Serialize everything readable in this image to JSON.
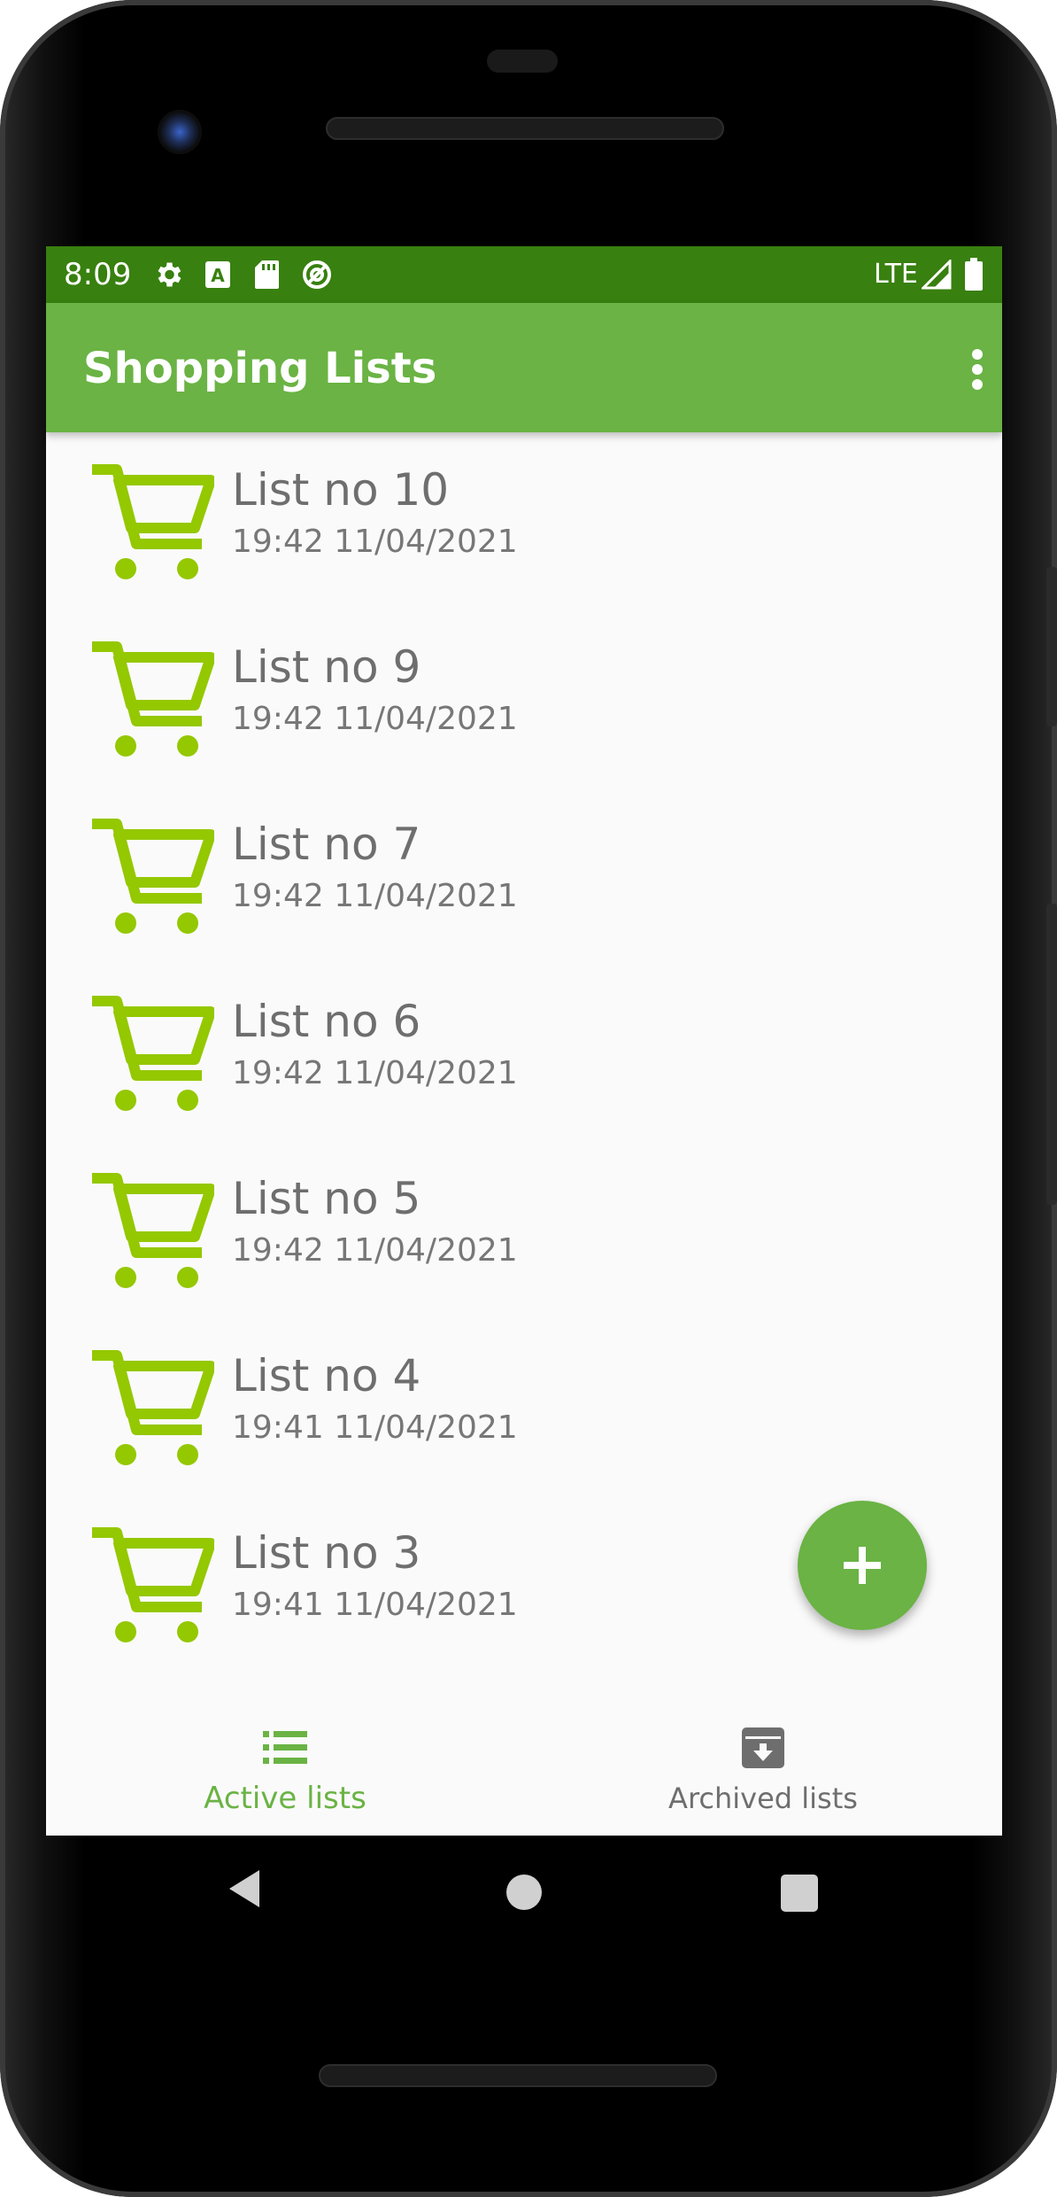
{
  "status_bar": {
    "time": "8:09",
    "icons": [
      "gear-icon",
      "a-notification-icon",
      "sd-card-icon",
      "no-sync-icon"
    ],
    "network": "LTE",
    "signal_icon": "signal-icon",
    "battery_icon": "battery-icon"
  },
  "app_bar": {
    "title": "Shopping Lists",
    "menu_icon": "more-vert-icon"
  },
  "lists": [
    {
      "name": "List no 10",
      "datetime": "19:42 11/04/2021"
    },
    {
      "name": "List no 9",
      "datetime": "19:42 11/04/2021"
    },
    {
      "name": "List no 7",
      "datetime": "19:42 11/04/2021"
    },
    {
      "name": "List no 6",
      "datetime": "19:42 11/04/2021"
    },
    {
      "name": "List no 5",
      "datetime": "19:42 11/04/2021"
    },
    {
      "name": "List no 4",
      "datetime": "19:41 11/04/2021"
    },
    {
      "name": "List no 3",
      "datetime": "19:41 11/04/2021"
    }
  ],
  "fab": {
    "icon": "plus-icon"
  },
  "bottom_nav": {
    "active": {
      "label": "Active lists",
      "icon": "list-icon"
    },
    "archived": {
      "label": "Archived lists",
      "icon": "archive-icon"
    }
  },
  "colors": {
    "status_bar": "#38800f",
    "app_bar": "#6ab344",
    "cart_icon": "#94c800",
    "active_tab": "#6ab344",
    "inactive_tab": "#6e6e6e"
  }
}
